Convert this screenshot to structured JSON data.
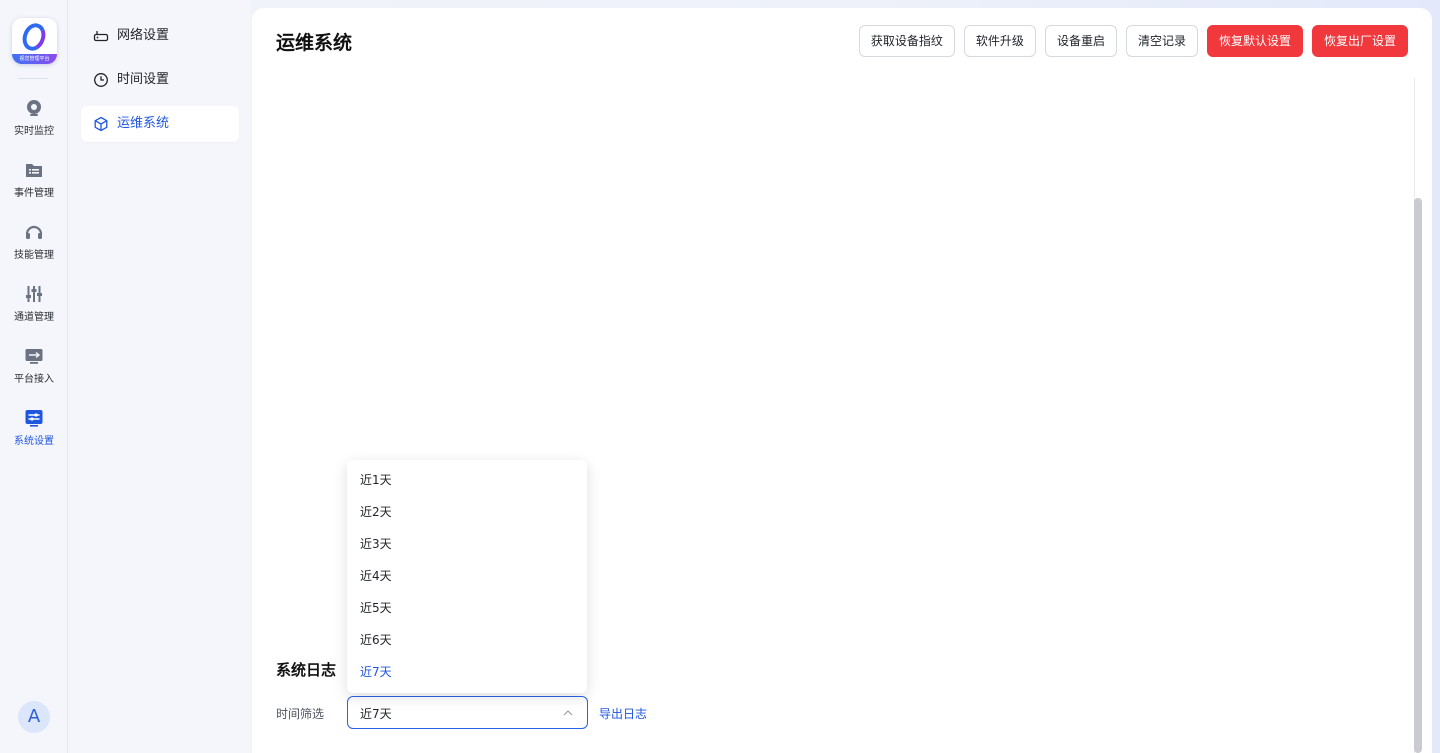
{
  "brand": {
    "tag": "视觉管理平台"
  },
  "rail": {
    "items": [
      {
        "label": "实时监控",
        "icon": "camera-icon"
      },
      {
        "label": "事件管理",
        "icon": "folder-list-icon"
      },
      {
        "label": "技能管理",
        "icon": "headset-icon"
      },
      {
        "label": "通道管理",
        "icon": "sliders-icon"
      },
      {
        "label": "平台接入",
        "icon": "monitor-arrow-icon"
      },
      {
        "label": "系统设置",
        "icon": "settings-panel-icon"
      }
    ],
    "active_index": 5,
    "avatar": "A"
  },
  "subnav": {
    "items": [
      {
        "label": "网络设置",
        "icon": "router-icon"
      },
      {
        "label": "时间设置",
        "icon": "clock-icon"
      },
      {
        "label": "运维系统",
        "icon": "cube-icon"
      }
    ],
    "active_index": 2
  },
  "main": {
    "title": "运维系统",
    "buttons": {
      "fingerprint": "获取设备指纹",
      "upgrade": "软件升级",
      "reboot": "设备重启",
      "clear": "清空记录",
      "restore_default": "恢复默认设置",
      "factory_reset": "恢复出厂设置"
    },
    "log": {
      "title": "系统日志",
      "filter_label": "时间筛选",
      "selected": "近7天",
      "export": "导出日志",
      "options": [
        "近1天",
        "近2天",
        "近3天",
        "近4天",
        "近5天",
        "近6天",
        "近7天"
      ]
    }
  },
  "colors": {
    "accent": "#1f56e0",
    "danger": "#f0383d"
  }
}
